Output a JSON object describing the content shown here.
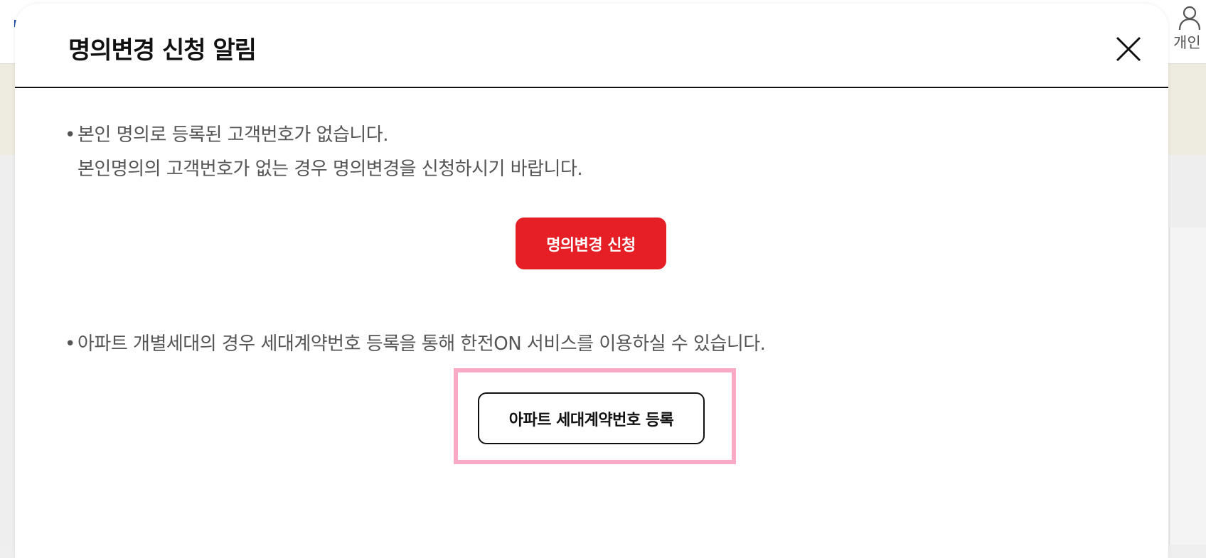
{
  "header": {
    "user_label": "개인"
  },
  "modal": {
    "title": "명의변경 신청 알림",
    "notice": {
      "bullet": "•",
      "line1": "본인 명의로 등록된 고객번호가 없습니다.",
      "line2": "본인명의의 고객번호가 없는 경우 명의변경을 신청하시기 바랍니다.",
      "line3": "아파트 개별세대의 경우 세대계약번호 등록을 통해 한전ON 서비스를 이용하실 수 있습니다."
    },
    "buttons": {
      "change_name": "명의변경 신청",
      "register_apartment": "아파트 세대계약번호 등록"
    }
  },
  "colors": {
    "primary_red": "#e61e25",
    "highlight_pink": "#f7a9c6"
  },
  "icons": {
    "close": "close-icon",
    "user": "user-icon"
  }
}
